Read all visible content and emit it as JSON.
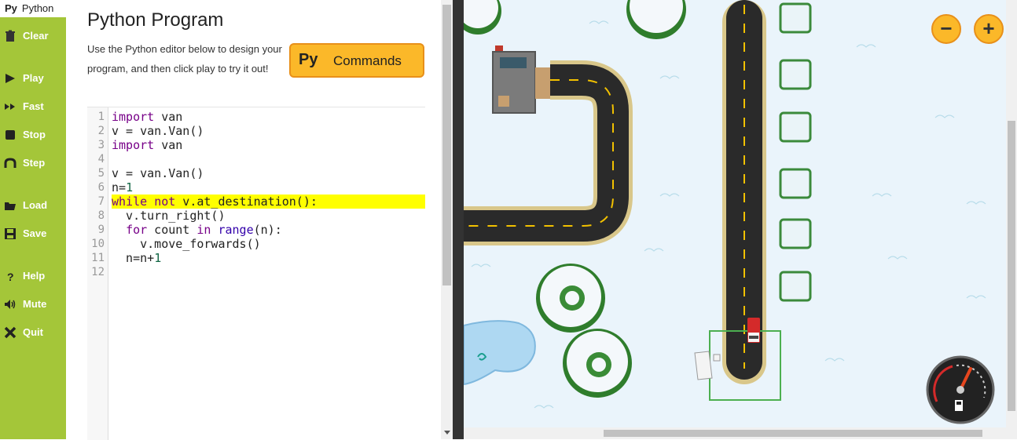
{
  "sidebar": {
    "tab": {
      "prefix": "Py",
      "label": "Python"
    },
    "items": [
      {
        "label": "Clear",
        "icon": "trash-icon"
      },
      {
        "label": "Play",
        "icon": "play-icon"
      },
      {
        "label": "Fast",
        "icon": "fast-forward-icon"
      },
      {
        "label": "Stop",
        "icon": "stop-icon"
      },
      {
        "label": "Step",
        "icon": "step-icon"
      },
      {
        "label": "Load",
        "icon": "folder-icon"
      },
      {
        "label": "Save",
        "icon": "floppy-icon"
      },
      {
        "label": "Help",
        "icon": "question-icon"
      },
      {
        "label": "Mute",
        "icon": "speaker-icon"
      },
      {
        "label": "Quit",
        "icon": "close-icon"
      }
    ]
  },
  "editor": {
    "title": "Python Program",
    "description": "Use the Python editor below to design your program, and then click play to try it out!",
    "commands_button": {
      "prefix": "Py",
      "label": "Commands"
    },
    "highlighted_line": 7,
    "line_numbers": [
      "1",
      "2",
      "3",
      "4",
      "5",
      "6",
      "7",
      "8",
      "9",
      "10",
      "11",
      "12"
    ],
    "code_lines": [
      "import van",
      "v = van.Van()",
      "import van",
      "",
      "v = van.Van()",
      "n=1",
      "while not v.at_destination():",
      "  v.turn_right()",
      "  for count in range(n):",
      "    v.move_forwards()",
      "  n=n+1",
      ""
    ]
  },
  "map": {
    "zoom_out_label": "−",
    "zoom_in_label": "+",
    "fuel_gauge": "fuel-gauge-icon"
  },
  "colors": {
    "sidebar": "#a4c639",
    "accent": "#fbb829",
    "highlight": "#ffff00",
    "snow": "#eaf4fb"
  }
}
